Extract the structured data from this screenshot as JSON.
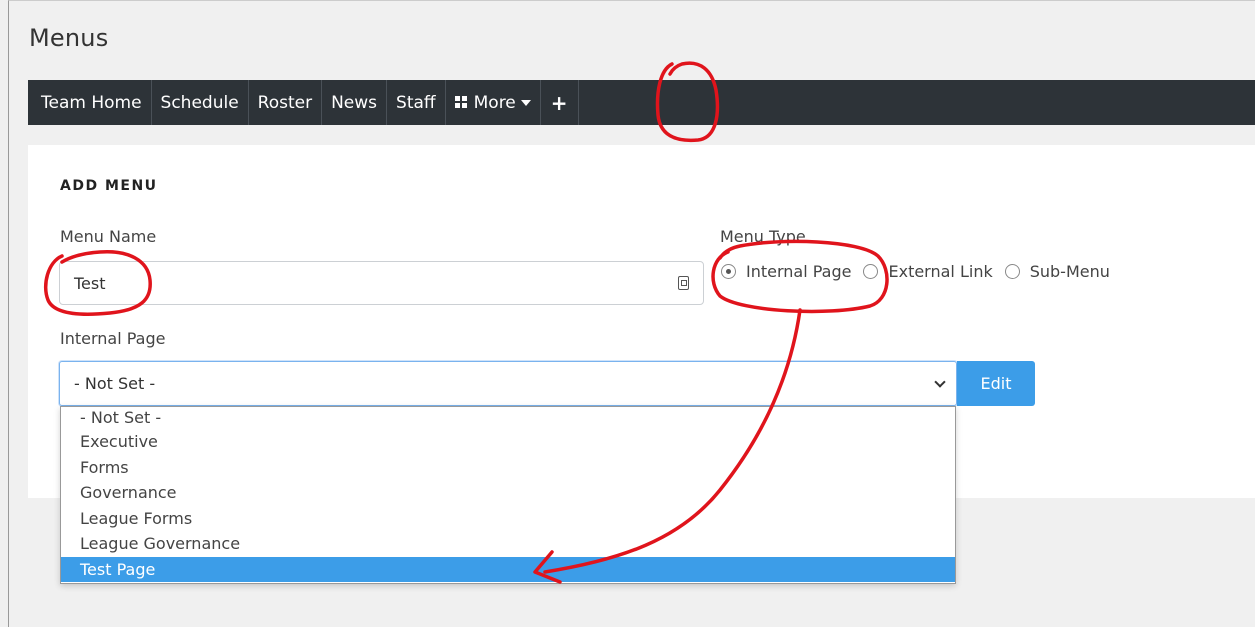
{
  "page": {
    "title": "Menus"
  },
  "navbar": {
    "items": [
      "Team Home",
      "Schedule",
      "Roster",
      "News",
      "Staff"
    ],
    "more_label": "More",
    "more_icon": "grid-icon",
    "add_label": "+",
    "background": "#2d3338"
  },
  "form": {
    "heading": "ADD MENU",
    "menu_name": {
      "label": "Menu Name",
      "value": "Test",
      "icon": "contact-card-icon"
    },
    "menu_type": {
      "label": "Menu Type",
      "options": [
        "Internal Page",
        "External Link",
        "Sub-Menu"
      ],
      "selected": "Internal Page"
    },
    "internal_page": {
      "label": "Internal Page",
      "selected_value": "- Not Set -",
      "edit_label": "Edit",
      "options": [
        "- Not Set -",
        "Executive",
        "Forms",
        "Governance",
        "League Forms",
        "League Governance",
        "Test Page"
      ],
      "highlighted": "Test Page"
    }
  },
  "colors": {
    "accent": "#3c9de8",
    "annotation": "#e0141c"
  }
}
